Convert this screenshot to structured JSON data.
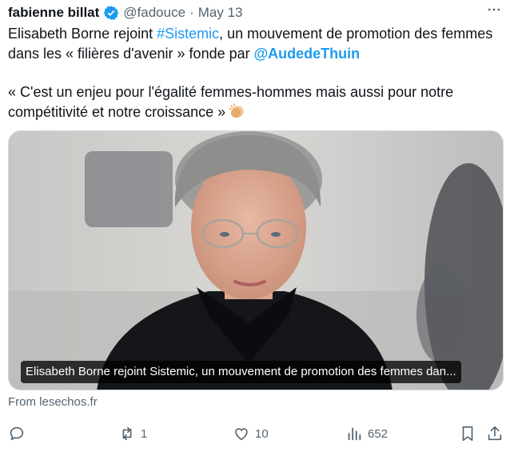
{
  "tweet": {
    "author_name": "fabienne billat",
    "handle": "@fadouce",
    "separator": "·",
    "date": "May 13",
    "text_part1": "Elisabeth Borne rejoint ",
    "hashtag": "#Sistemic",
    "text_part2": ", un mouvement de promotion des femmes dans les « filières d'avenir » fonde par ",
    "mention": "@AudedeThuin",
    "quote": "« C'est un enjeu pour l'égalité femmes-hommes mais aussi pour notre compétitivité et notre croissance »",
    "emoji": "clapping-hands-emoji"
  },
  "card": {
    "caption": "Elisabeth Borne rejoint Sistemic, un mouvement de promotion des femmes dan...",
    "source": "From lesechos.fr"
  },
  "actions": {
    "reply_count": "",
    "retweet_count": "1",
    "like_count": "10",
    "views_count": "652"
  },
  "icons": [
    "verified-badge-icon",
    "more-icon",
    "reply-icon",
    "retweet-icon",
    "like-icon",
    "views-icon",
    "bookmark-icon",
    "share-icon"
  ],
  "colors": {
    "accent": "#1d9bf0",
    "muted": "#536471",
    "text": "#0f1419"
  }
}
